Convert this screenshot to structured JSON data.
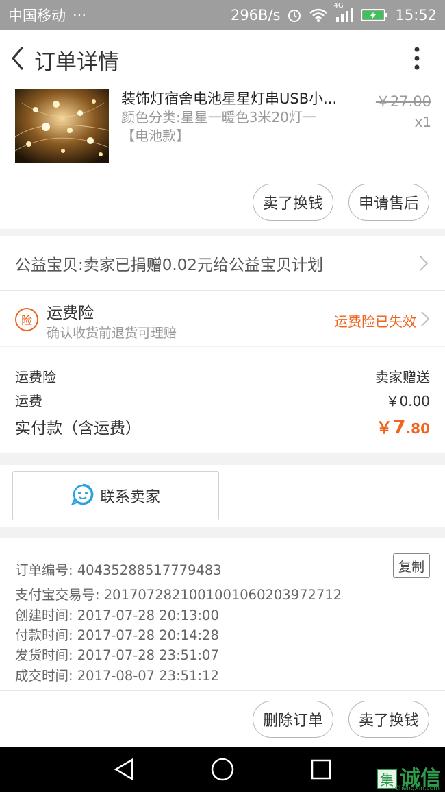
{
  "status_bar": {
    "carrier": "中国移动",
    "dots": "···",
    "speed": "296B/s",
    "network": "4G",
    "time": "15:52"
  },
  "header": {
    "title": "订单详情"
  },
  "product": {
    "title": "装饰灯宿舍电池星星灯串USB小...",
    "sku": "颜色分类:星星一暖色3米20灯一【电池款】",
    "price": "￥27.00",
    "quantity": "x1",
    "actions": {
      "sell_label": "卖了换钱",
      "after_sale_label": "申请售后"
    }
  },
  "charity": {
    "text": "公益宝贝:卖家已捐赠0.02元给公益宝贝计划"
  },
  "insurance": {
    "badge": "险",
    "title": "运费险",
    "subtitle": "确认收货前退货可理赔",
    "status": "运费险已失效",
    "status_color": "#f0641e"
  },
  "fees": {
    "insurance_label": "运费险",
    "insurance_value": "卖家赠送",
    "shipping_label": "运费",
    "shipping_value": "￥0.00",
    "total_label": "实付款（含运费）",
    "total_currency": "￥",
    "total_int": "7",
    "total_dec": ".80"
  },
  "contact": {
    "label": "联系卖家"
  },
  "order_info": {
    "order_no": "订单编号: 40435288517779483",
    "copy_label": "复制",
    "alipay_no": "支付宝交易号: 2017072821001001060203972712",
    "created": "创建时间: 2017-07-28 20:13:00",
    "paid": "付款时间: 2017-07-28 20:14:28",
    "shipped": "发货时间: 2017-07-28 23:51:07",
    "completed": "成交时间: 2017-08-07 23:51:12"
  },
  "bottom_actions": {
    "delete_label": "删除订单",
    "sell_label": "卖了换钱"
  },
  "watermark": {
    "logo_char": "集",
    "text": "诚信",
    "sub": "JiChengXin.com"
  },
  "icons": {
    "back": "chevron-left-icon",
    "more": "more-vertical-icon",
    "contact": "chat-bubble-icon"
  }
}
